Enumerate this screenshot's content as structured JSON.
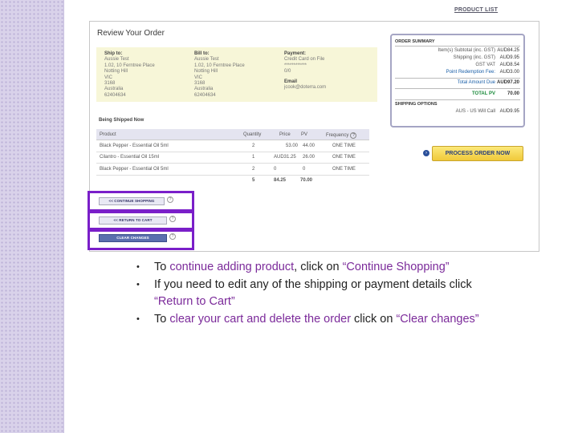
{
  "top_link": "PRODUCT LIST",
  "review": {
    "title": "Review Your Order",
    "ship_to": {
      "heading": "Ship to:",
      "lines": [
        "Aussie Test",
        "1.02, 10 Ferntree Place",
        "Notting Hill",
        "VIC",
        "3168",
        "Australia",
        "62404634"
      ]
    },
    "bill_to": {
      "heading": "Bill to:",
      "lines": [
        "Aussie Test",
        "1.02, 10 Ferntree Place",
        "Notting Hill",
        "VIC",
        "3168",
        "Australia",
        "62404634"
      ]
    },
    "payment": {
      "heading": "Payment:",
      "method": "Credit Card on File",
      "masked": "************",
      "expiry": "0/0",
      "email_heading": "Email",
      "email": "jcook@doterra.com"
    },
    "being_shipped": "Being Shipped Now",
    "table": {
      "headers": [
        "Product",
        "Quantity",
        "Price",
        "PV",
        "Frequency"
      ],
      "rows": [
        [
          "Black Pepper - Essential Oil 5ml",
          "2",
          "53.00",
          "44.00",
          "ONE TIME"
        ],
        [
          "Cilantro - Essential Oil 15ml",
          "1",
          "AUD31.25",
          "26.00",
          "ONE TIME"
        ],
        [
          "Black Pepper - Essential Oil 5ml",
          "2",
          "0",
          "0",
          "ONE TIME"
        ]
      ],
      "totals": [
        "5",
        "84.25",
        "70.00"
      ]
    },
    "buttons": {
      "continue": "<< CONTINUE SHOPPING",
      "return": "<< RETURN TO CART",
      "clear": "CLEAR CHANGES"
    },
    "summary": {
      "heading": "ORDER SUMMARY",
      "rows": [
        {
          "label": "Item(s) Subtotal (inc. GST)",
          "value": "AUD84.25"
        },
        {
          "label": "Shipping (inc. GST)",
          "value": "AUD9.95"
        },
        {
          "label": "GST VAT",
          "value": "AUD8.54"
        },
        {
          "label": "Point Redemption Fee:",
          "value": "AUD3.00"
        }
      ],
      "total_label": "Total Amount Due",
      "total_value": "AUD97.20",
      "pv_label": "TOTAL PV",
      "pv_value": "70.00",
      "shipping_heading": "SHIPPING OPTIONS",
      "shipping_label": "AUS - US Will Call",
      "shipping_value": "AUD9.95"
    },
    "process_button": "PROCESS ORDER NOW"
  },
  "bullets": {
    "b1_pre": "To ",
    "b1_hl": "continue adding product",
    "b1_mid": ", click on ",
    "b1_q": "“Continue Shopping”",
    "b2_pre": "If you need to edit any of the shipping or payment details click ",
    "b2_q": "“Return to Cart”",
    "b3_pre": "To ",
    "b3_hl": "clear your cart and delete the order",
    "b3_mid": " click on ",
    "b3_q": "“Clear changes”"
  },
  "colors": {
    "highlight": "#7a1fc9",
    "accent_purple": "#7b2a9a",
    "sidebar": "#d9d2ea"
  }
}
